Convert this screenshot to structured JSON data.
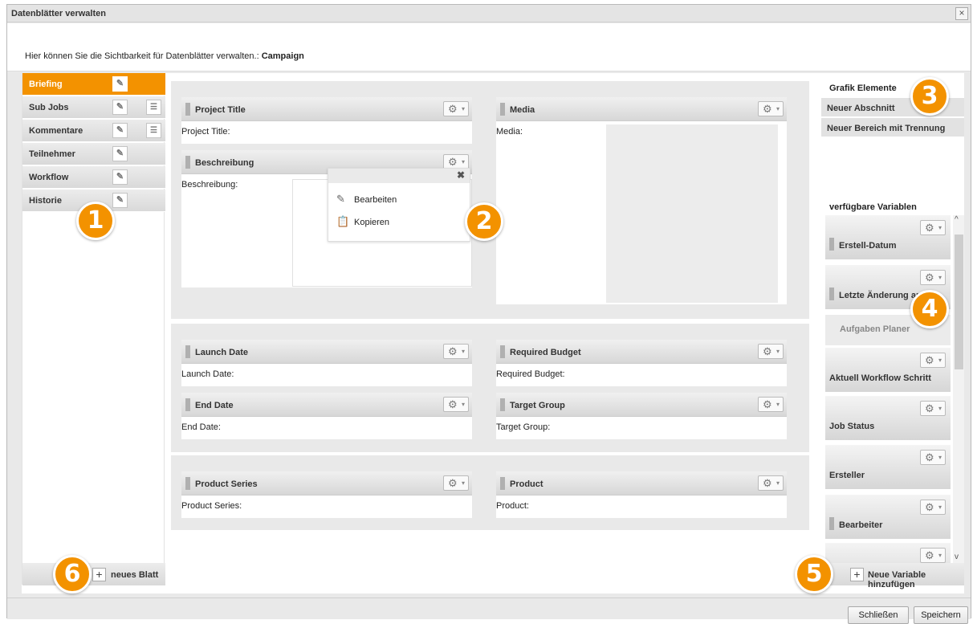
{
  "window": {
    "title": "Datenblätter verwalten",
    "close_glyph": "×"
  },
  "description": {
    "text": "Hier können Sie die Sichtbarkeit für Datenblätter verwalten.:",
    "campaign": "Campaign"
  },
  "sheets": {
    "items": [
      {
        "label": "Briefing",
        "active": true
      },
      {
        "label": "Sub Jobs"
      },
      {
        "label": "Kommentare"
      },
      {
        "label": "Teilnehmer"
      },
      {
        "label": "Workflow"
      },
      {
        "label": "Historie"
      }
    ],
    "new_label": "neues Blatt"
  },
  "icons": {
    "pencil": "pencil-icon",
    "list": "list-icon",
    "gear": "gear-icon",
    "plus": "plus-icon",
    "close": "close-icon",
    "clipboard": "clipboard-icon"
  },
  "fields": {
    "project_title": {
      "title": "Project Title",
      "label": "Project Title:"
    },
    "beschreibung": {
      "title": "Beschreibung",
      "label": "Beschreibung:"
    },
    "media": {
      "title": "Media",
      "label": "Media:"
    },
    "launch_date": {
      "title": "Launch Date",
      "label": "Launch Date:"
    },
    "required_budget": {
      "title": "Required Budget",
      "label": "Required Budget:"
    },
    "end_date": {
      "title": "End Date",
      "label": "End Date:"
    },
    "target_group": {
      "title": "Target Group",
      "label": "Target Group:"
    },
    "product_series": {
      "title": "Product Series",
      "label": "Product Series:"
    },
    "product": {
      "title": "Product",
      "label": "Product:"
    }
  },
  "context_menu": {
    "edit": "Bearbeiten",
    "copy": "Kopieren"
  },
  "graphic_elements": {
    "heading": "Grafik Elemente",
    "items": [
      "Neuer Abschnitt",
      "Neuer Bereich mit Trennung"
    ]
  },
  "variables": {
    "heading": "verfügbare Variablen",
    "items": [
      "Erstell-Datum",
      "Letzte Änderung am",
      "Aufgaben Planer",
      "Aktuell Workflow Schritt",
      "Job Status",
      "Ersteller",
      "Bearbeiter"
    ],
    "add_label": "Neue Variable hinzufügen"
  },
  "badges": [
    "1",
    "2",
    "3",
    "4",
    "5",
    "6"
  ],
  "footer": {
    "close": "Schließen",
    "save": "Speichern"
  },
  "colors": {
    "accent": "#f39200"
  }
}
